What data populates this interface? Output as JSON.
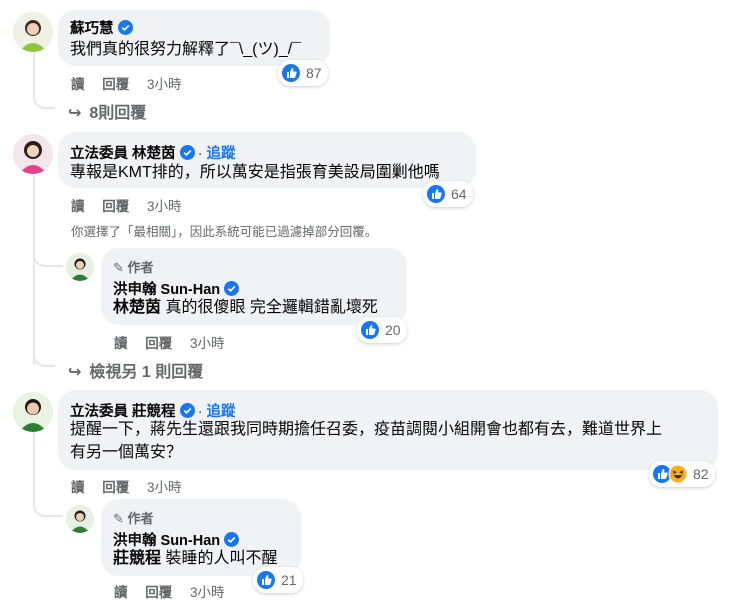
{
  "comments": [
    {
      "name": "蘇巧慧",
      "text": "我們真的很努力解釋了¯\\_(ツ)_/¯",
      "actions": {
        "read": "讀",
        "reply": "回覆",
        "time": "3小時"
      },
      "reactions": "87",
      "more_replies": "8則回覆"
    },
    {
      "name": "立法委員 林楚茵",
      "follow": "追蹤",
      "text": "專報是KMT排的，所以萬安是指張育美設局圍剿他嗎",
      "actions": {
        "read": "讀",
        "reply": "回覆",
        "time": "3小時"
      },
      "reactions": "64",
      "filter_note": "你選擇了「最相關」，因此系統可能已過濾掉部分回覆。",
      "reply": {
        "author_tag": "作者",
        "name": "洪申翰 Sun-Han",
        "mention": "林楚茵",
        "text": " 真的很傻眼 完全邏輯錯亂壞死",
        "actions": {
          "read": "讀",
          "reply": "回覆",
          "time": "3小時"
        },
        "reactions": "20"
      },
      "more_replies": "檢視另 1 則回覆"
    },
    {
      "name": "立法委員 莊競程",
      "follow": "追蹤",
      "text_line1": "提醒一下，蔣先生還跟我同時期擔任召委，疫苗調閱小組開會也都有去，難道世界上",
      "text_line2": "有另一個萬安？",
      "actions": {
        "read": "讀",
        "reply": "回覆",
        "time": "3小時"
      },
      "reactions": "82",
      "reply": {
        "author_tag": "作者",
        "name": "洪申翰 Sun-Han",
        "mention": "莊競程",
        "text": " 裝睡的人叫不醒",
        "actions": {
          "read": "讀",
          "reply": "回覆",
          "time": "3小時"
        },
        "reactions": "21"
      }
    }
  ],
  "colors": {
    "link": "#1877f2",
    "bubble": "#f0f2f5",
    "secondary_text": "#65676b"
  }
}
